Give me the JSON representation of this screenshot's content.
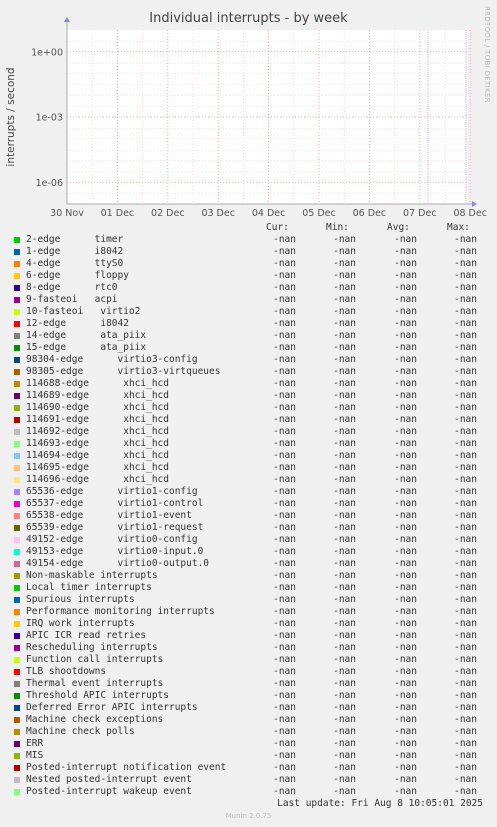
{
  "title": "Individual interrupts - by week",
  "side_label": "RRDTOOL / TOBI OETIKER",
  "footer": "Last update: Fri Aug  8 10:05:01 2025",
  "munin_version": "Munin 2.0.75",
  "headers": {
    "cur": "Cur:",
    "min": "Min:",
    "avg": "Avg:",
    "max": "Max:"
  },
  "chart_data": {
    "type": "line",
    "title": "Individual interrupts - by week",
    "xlabel": "",
    "ylabel": "interrupts / second",
    "y_scale": "log",
    "ylim": [
      1e-07,
      10
    ],
    "y_ticks": [
      "1e-06",
      "1e-03",
      "1e+00"
    ],
    "x_ticks": [
      "30 Nov",
      "01 Dec",
      "02 Dec",
      "03 Dec",
      "04 Dec",
      "05 Dec",
      "06 Dec",
      "07 Dec",
      "08 Dec"
    ],
    "grid": true,
    "colors": {
      "grid_major": "#e8a0a0",
      "grid_minor": "#f0c8c8",
      "vline": "#d9a0d0",
      "axis": "#aaaaaa",
      "arrow": "#8888ee",
      "bg": "#ffffff"
    },
    "series": [
      {
        "name": "2-edge      timer",
        "color": "#00cc00",
        "cur": "-nan",
        "min": "-nan",
        "avg": "-nan",
        "max": "-nan"
      },
      {
        "name": "1-edge      i8042",
        "color": "#0066b3",
        "cur": "-nan",
        "min": "-nan",
        "avg": "-nan",
        "max": "-nan"
      },
      {
        "name": "4-edge      ttyS0",
        "color": "#ff8000",
        "cur": "-nan",
        "min": "-nan",
        "avg": "-nan",
        "max": "-nan"
      },
      {
        "name": "6-edge      floppy",
        "color": "#ffcc00",
        "cur": "-nan",
        "min": "-nan",
        "avg": "-nan",
        "max": "-nan"
      },
      {
        "name": "8-edge      rtc0",
        "color": "#330099",
        "cur": "-nan",
        "min": "-nan",
        "avg": "-nan",
        "max": "-nan"
      },
      {
        "name": "9-fasteoi   acpi",
        "color": "#990099",
        "cur": "-nan",
        "min": "-nan",
        "avg": "-nan",
        "max": "-nan"
      },
      {
        "name": "10-fasteoi   virtio2",
        "color": "#ccff00",
        "cur": "-nan",
        "min": "-nan",
        "avg": "-nan",
        "max": "-nan"
      },
      {
        "name": "12-edge      i8042",
        "color": "#ff0000",
        "cur": "-nan",
        "min": "-nan",
        "avg": "-nan",
        "max": "-nan"
      },
      {
        "name": "14-edge      ata_piix",
        "color": "#808080",
        "cur": "-nan",
        "min": "-nan",
        "avg": "-nan",
        "max": "-nan"
      },
      {
        "name": "15-edge      ata_piix",
        "color": "#008f00",
        "cur": "-nan",
        "min": "-nan",
        "avg": "-nan",
        "max": "-nan"
      },
      {
        "name": "98304-edge      virtio3-config",
        "color": "#00487d",
        "cur": "-nan",
        "min": "-nan",
        "avg": "-nan",
        "max": "-nan"
      },
      {
        "name": "98305-edge      virtio3-virtqueues",
        "color": "#b35a00",
        "cur": "-nan",
        "min": "-nan",
        "avg": "-nan",
        "max": "-nan"
      },
      {
        "name": "114688-edge      xhci_hcd",
        "color": "#b38f00",
        "cur": "-nan",
        "min": "-nan",
        "avg": "-nan",
        "max": "-nan"
      },
      {
        "name": "114689-edge      xhci_hcd",
        "color": "#6b006b",
        "cur": "-nan",
        "min": "-nan",
        "avg": "-nan",
        "max": "-nan"
      },
      {
        "name": "114690-edge      xhci_hcd",
        "color": "#8fb300",
        "cur": "-nan",
        "min": "-nan",
        "avg": "-nan",
        "max": "-nan"
      },
      {
        "name": "114691-edge      xhci_hcd",
        "color": "#b30000",
        "cur": "-nan",
        "min": "-nan",
        "avg": "-nan",
        "max": "-nan"
      },
      {
        "name": "114692-edge      xhci_hcd",
        "color": "#bebebe",
        "cur": "-nan",
        "min": "-nan",
        "avg": "-nan",
        "max": "-nan"
      },
      {
        "name": "114693-edge      xhci_hcd",
        "color": "#80ff80",
        "cur": "-nan",
        "min": "-nan",
        "avg": "-nan",
        "max": "-nan"
      },
      {
        "name": "114694-edge      xhci_hcd",
        "color": "#80c9ff",
        "cur": "-nan",
        "min": "-nan",
        "avg": "-nan",
        "max": "-nan"
      },
      {
        "name": "114695-edge      xhci_hcd",
        "color": "#ffc080",
        "cur": "-nan",
        "min": "-nan",
        "avg": "-nan",
        "max": "-nan"
      },
      {
        "name": "114696-edge      xhci_hcd",
        "color": "#ffe680",
        "cur": "-nan",
        "min": "-nan",
        "avg": "-nan",
        "max": "-nan"
      },
      {
        "name": "65536-edge      virtio1-config",
        "color": "#aa80ff",
        "cur": "-nan",
        "min": "-nan",
        "avg": "-nan",
        "max": "-nan"
      },
      {
        "name": "65537-edge      virtio1-control",
        "color": "#ee00cc",
        "cur": "-nan",
        "min": "-nan",
        "avg": "-nan",
        "max": "-nan"
      },
      {
        "name": "65538-edge      virtio1-event",
        "color": "#ff8080",
        "cur": "-nan",
        "min": "-nan",
        "avg": "-nan",
        "max": "-nan"
      },
      {
        "name": "65539-edge      virtio1-request",
        "color": "#666600",
        "cur": "-nan",
        "min": "-nan",
        "avg": "-nan",
        "max": "-nan"
      },
      {
        "name": "49152-edge      virtio0-config",
        "color": "#ffbfff",
        "cur": "-nan",
        "min": "-nan",
        "avg": "-nan",
        "max": "-nan"
      },
      {
        "name": "49153-edge      virtio0-input.0",
        "color": "#00ffcc",
        "cur": "-nan",
        "min": "-nan",
        "avg": "-nan",
        "max": "-nan"
      },
      {
        "name": "49154-edge      virtio0-output.0",
        "color": "#cc6699",
        "cur": "-nan",
        "min": "-nan",
        "avg": "-nan",
        "max": "-nan"
      },
      {
        "name": "Non-maskable interrupts",
        "color": "#999900",
        "cur": "-nan",
        "min": "-nan",
        "avg": "-nan",
        "max": "-nan"
      },
      {
        "name": "Local timer interrupts",
        "color": "#00cc00",
        "cur": "-nan",
        "min": "-nan",
        "avg": "-nan",
        "max": "-nan"
      },
      {
        "name": "Spurious interrupts",
        "color": "#0066b3",
        "cur": "-nan",
        "min": "-nan",
        "avg": "-nan",
        "max": "-nan"
      },
      {
        "name": "Performance monitoring interrupts",
        "color": "#ff8000",
        "cur": "-nan",
        "min": "-nan",
        "avg": "-nan",
        "max": "-nan"
      },
      {
        "name": "IRQ work interrupts",
        "color": "#ffcc00",
        "cur": "-nan",
        "min": "-nan",
        "avg": "-nan",
        "max": "-nan"
      },
      {
        "name": "APIC ICR read retries",
        "color": "#330099",
        "cur": "-nan",
        "min": "-nan",
        "avg": "-nan",
        "max": "-nan"
      },
      {
        "name": "Rescheduling interrupts",
        "color": "#990099",
        "cur": "-nan",
        "min": "-nan",
        "avg": "-nan",
        "max": "-nan"
      },
      {
        "name": "Function call interrupts",
        "color": "#ccff00",
        "cur": "-nan",
        "min": "-nan",
        "avg": "-nan",
        "max": "-nan"
      },
      {
        "name": "TLB shootdowns",
        "color": "#ff0000",
        "cur": "-nan",
        "min": "-nan",
        "avg": "-nan",
        "max": "-nan"
      },
      {
        "name": "Thermal event interrupts",
        "color": "#808080",
        "cur": "-nan",
        "min": "-nan",
        "avg": "-nan",
        "max": "-nan"
      },
      {
        "name": "Threshold APIC interrupts",
        "color": "#008f00",
        "cur": "-nan",
        "min": "-nan",
        "avg": "-nan",
        "max": "-nan"
      },
      {
        "name": "Deferred Error APIC interrupts",
        "color": "#00487d",
        "cur": "-nan",
        "min": "-nan",
        "avg": "-nan",
        "max": "-nan"
      },
      {
        "name": "Machine check exceptions",
        "color": "#b35a00",
        "cur": "-nan",
        "min": "-nan",
        "avg": "-nan",
        "max": "-nan"
      },
      {
        "name": "Machine check polls",
        "color": "#b38f00",
        "cur": "-nan",
        "min": "-nan",
        "avg": "-nan",
        "max": "-nan"
      },
      {
        "name": "ERR",
        "color": "#6b006b",
        "cur": "-nan",
        "min": "-nan",
        "avg": "-nan",
        "max": "-nan"
      },
      {
        "name": "MIS",
        "color": "#8fb300",
        "cur": "-nan",
        "min": "-nan",
        "avg": "-nan",
        "max": "-nan"
      },
      {
        "name": "Posted-interrupt notification event",
        "color": "#b30000",
        "cur": "-nan",
        "min": "-nan",
        "avg": "-nan",
        "max": "-nan"
      },
      {
        "name": "Nested posted-interrupt event",
        "color": "#bebebe",
        "cur": "-nan",
        "min": "-nan",
        "avg": "-nan",
        "max": "-nan"
      },
      {
        "name": "Posted-interrupt wakeup event",
        "color": "#80ff80",
        "cur": "-nan",
        "min": "-nan",
        "avg": "-nan",
        "max": "-nan"
      }
    ]
  }
}
